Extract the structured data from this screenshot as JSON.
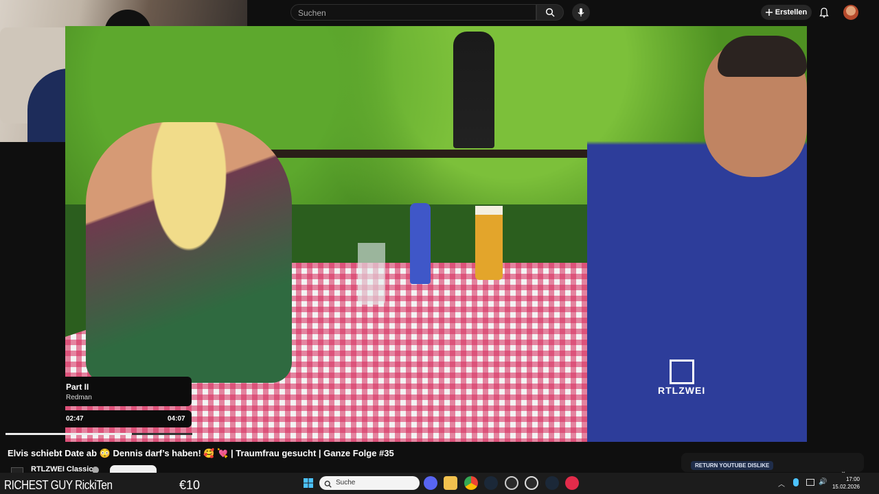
{
  "header": {
    "search_placeholder": "Suchen",
    "create_label": "Erstellen",
    "icons": [
      "search-icon",
      "mic-icon",
      "plus-icon",
      "bell-icon",
      "avatar"
    ]
  },
  "video": {
    "watermark": "RTLZWEI",
    "title": "Elvis schiebt Date ab 😳 Dennis darf’s haben! 🥰 💘 | Traumfrau gesucht | Ganze Folge #35"
  },
  "music_overlay": {
    "title": "Part II",
    "artist": "Redman",
    "elapsed": "02:47",
    "duration": "04:07",
    "progress": 0.676
  },
  "channel": {
    "name": "RTLZWEI Classics"
  },
  "extension": {
    "ryd_label": "RETURN YOUTUBE DISLIKE"
  },
  "stream_overlay": {
    "name": "RICHEST GUY RickiTen",
    "amount": "€10"
  },
  "taskbar": {
    "search_label": "Suche",
    "time": "17:00",
    "date": "15.02.2026"
  },
  "colors": {
    "background": "#0f0f0f",
    "accent": "#f1f1f1",
    "ryd_badge": "#1f2d4a"
  }
}
